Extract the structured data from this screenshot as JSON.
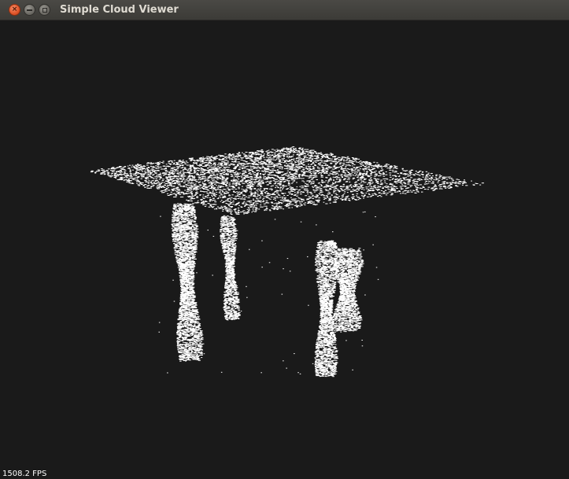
{
  "window": {
    "title": "Simple Cloud Viewer",
    "close_glyph": "×",
    "background_color": "#1a1a1a",
    "point_color": "#ffffff"
  },
  "icons": {
    "close": "close-icon",
    "minimize": "minimize-icon",
    "maximize": "maximize-icon"
  },
  "viewer": {
    "fps_text": "1508.2 FPS",
    "content": "point cloud of a table with four legs"
  }
}
